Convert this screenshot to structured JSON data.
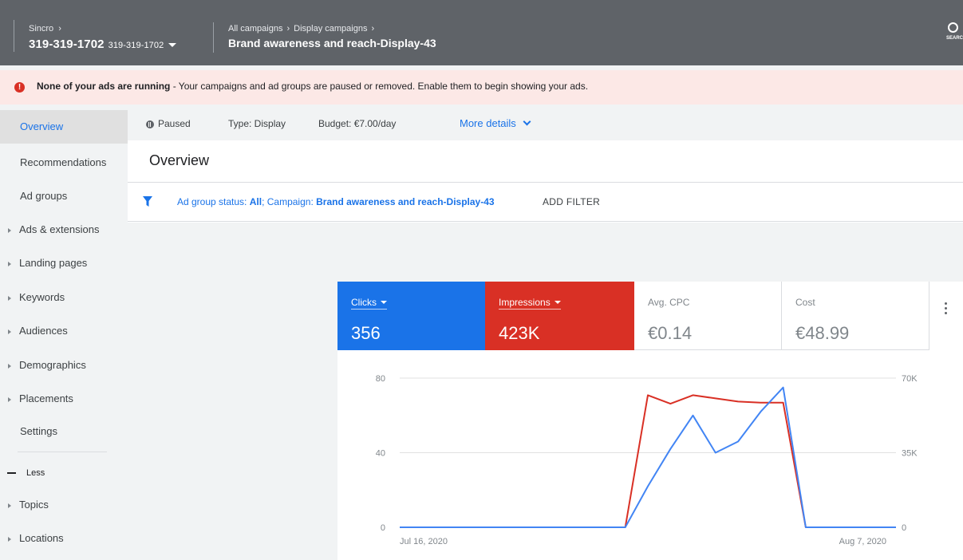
{
  "header": {
    "account_crumb": "Sincro",
    "account_id": "319-319-1702",
    "account_id_small": "319-319-1702",
    "crumb_1": "All campaigns",
    "crumb_2": "Display campaigns",
    "campaign_title": "Brand awareness and reach-Display-43",
    "search_label": "SEARCH"
  },
  "alert": {
    "bold": "None of your ads are running",
    "rest": " - Your campaigns and ad groups are paused or removed. Enable them to begin showing your ads."
  },
  "sidebar": {
    "items": [
      {
        "label": "Overview"
      },
      {
        "label": "Recommendations"
      },
      {
        "label": "Ad groups"
      },
      {
        "label": "Ads & extensions"
      },
      {
        "label": "Landing pages"
      },
      {
        "label": "Keywords"
      },
      {
        "label": "Audiences"
      },
      {
        "label": "Demographics"
      },
      {
        "label": "Placements"
      },
      {
        "label": "Settings"
      }
    ],
    "less_label": "Less",
    "more_items": [
      {
        "label": "Topics"
      },
      {
        "label": "Locations"
      }
    ]
  },
  "summary": {
    "status": "Paused",
    "type": "Type: Display",
    "budget": "Budget: €7.00/day",
    "more_details": "More details"
  },
  "overview": {
    "title": "Overview",
    "filter_prefix": "Ad group status: ",
    "filter_status_value": "All",
    "filter_mid": "; Campaign: ",
    "filter_campaign_value": "Brand awareness and reach-Display-43",
    "add_filter": "ADD FILTER"
  },
  "metrics": [
    {
      "label": "Clicks",
      "value": "356",
      "selected": true,
      "color": "#1a73e8"
    },
    {
      "label": "Impressions",
      "value": "423K",
      "selected": true,
      "color": "#d93025"
    },
    {
      "label": "Avg. CPC",
      "value": "€0.14",
      "selected": false
    },
    {
      "label": "Cost",
      "value": "€48.99",
      "selected": false
    }
  ],
  "chart_data": {
    "type": "line",
    "x_start_label": "Jul 16, 2020",
    "x_end_label": "Aug 7, 2020",
    "x": [
      "Jul 16",
      "Jul 17",
      "Jul 18",
      "Jul 19",
      "Jul 20",
      "Jul 21",
      "Jul 22",
      "Jul 23",
      "Jul 24",
      "Jul 25",
      "Jul 26",
      "Jul 27",
      "Jul 28",
      "Jul 29",
      "Jul 30",
      "Jul 31",
      "Aug 1",
      "Aug 2",
      "Aug 3",
      "Aug 4",
      "Aug 5",
      "Aug 6",
      "Aug 7"
    ],
    "y_left_ticks": [
      "80",
      "40",
      "0"
    ],
    "y_right_ticks": [
      "70K",
      "35K",
      "0"
    ],
    "y_left_range": [
      0,
      80
    ],
    "y_right_range": [
      0,
      70000
    ],
    "series": [
      {
        "name": "Clicks",
        "axis": "left",
        "color": "#4285f4",
        "values": [
          0,
          0,
          0,
          0,
          0,
          0,
          0,
          0,
          0,
          0,
          0,
          22,
          42,
          60,
          40,
          46,
          62,
          75,
          0,
          0,
          0,
          0,
          0
        ]
      },
      {
        "name": "Impressions",
        "axis": "right",
        "color": "#d93025",
        "values": [
          0,
          0,
          0,
          0,
          0,
          0,
          0,
          0,
          0,
          0,
          0,
          62000,
          58000,
          62000,
          60500,
          59000,
          58500,
          58500,
          0,
          0,
          0,
          0,
          0
        ]
      }
    ],
    "grid": true
  }
}
